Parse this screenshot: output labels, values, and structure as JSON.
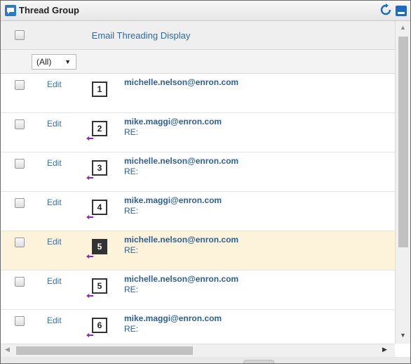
{
  "window": {
    "title": "Thread Group",
    "app_icon": "app-icon",
    "refresh_icon": "refresh-icon",
    "minimize_icon": "minimize-icon",
    "accent": "#1e6bbd"
  },
  "grid": {
    "header": {
      "column_title": "Email Threading Display"
    },
    "filter": {
      "selected": "(All)"
    },
    "rows": [
      {
        "edit": "Edit",
        "number": "1",
        "email": "michelle.nelson@enron.com",
        "subject": "",
        "reply": false,
        "selected": false
      },
      {
        "edit": "Edit",
        "number": "2",
        "email": "mike.maggi@enron.com",
        "subject": "RE:",
        "reply": true,
        "selected": false
      },
      {
        "edit": "Edit",
        "number": "3",
        "email": "michelle.nelson@enron.com",
        "subject": "RE:",
        "reply": true,
        "selected": false
      },
      {
        "edit": "Edit",
        "number": "4",
        "email": "mike.maggi@enron.com",
        "subject": "RE:",
        "reply": true,
        "selected": false
      },
      {
        "edit": "Edit",
        "number": "5",
        "email": "michelle.nelson@enron.com",
        "subject": "RE:",
        "reply": true,
        "selected": true
      },
      {
        "edit": "Edit",
        "number": "5",
        "email": "michelle.nelson@enron.com",
        "subject": "RE:",
        "reply": true,
        "selected": false
      },
      {
        "edit": "Edit",
        "number": "6",
        "email": "mike.maggi@enron.com",
        "subject": "RE:",
        "reply": true,
        "selected": false
      }
    ],
    "selected_row_color": "#fdf3db",
    "link_color": "#2e5f94"
  }
}
